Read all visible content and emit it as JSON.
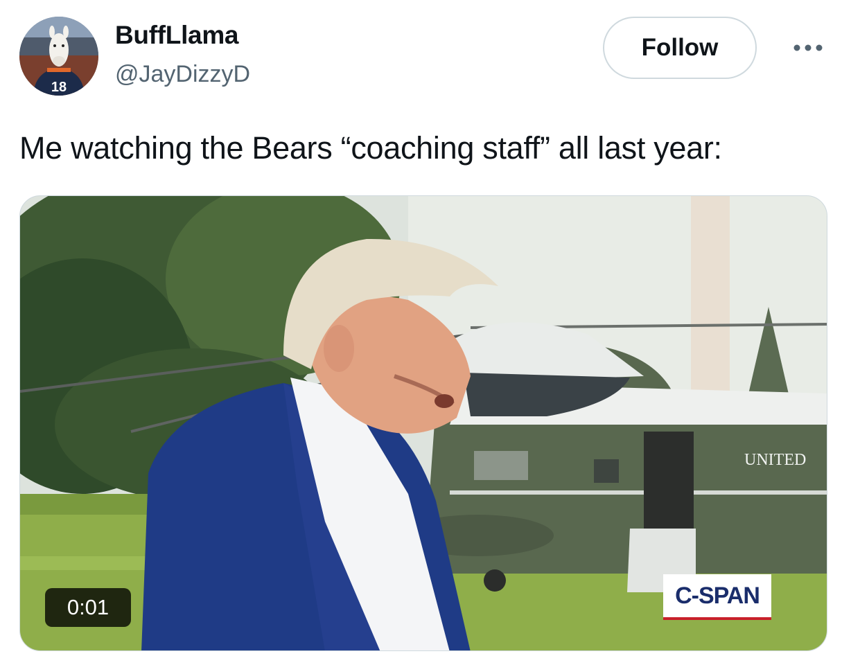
{
  "tweet": {
    "author_name": "BuffLlama",
    "author_handle": "@JayDizzyD",
    "follow_label": "Follow",
    "more_icon": "more-options-icon",
    "text": "Me watching the Bears “coaching staff” all last year:",
    "avatar_jersey_number": "18"
  },
  "video": {
    "timestamp": "0:01",
    "watermark": "C-SPAN",
    "aircraft_lettering": "UNITED"
  },
  "colors": {
    "follow_border": "#cfd9de",
    "handle_gray": "#536471",
    "text": "#0f1419"
  }
}
